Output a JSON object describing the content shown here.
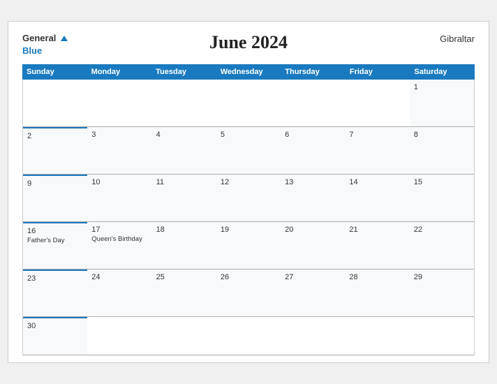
{
  "header": {
    "logo_general": "General",
    "logo_blue": "Blue",
    "title": "June 2024",
    "region": "Gibraltar"
  },
  "days": [
    "Sunday",
    "Monday",
    "Tuesday",
    "Wednesday",
    "Thursday",
    "Friday",
    "Saturday"
  ],
  "weeks": [
    [
      {
        "date": "",
        "empty": true
      },
      {
        "date": "",
        "empty": true
      },
      {
        "date": "",
        "empty": true
      },
      {
        "date": "",
        "empty": true
      },
      {
        "date": "",
        "empty": true
      },
      {
        "date": "",
        "empty": true
      },
      {
        "date": "1",
        "events": []
      }
    ],
    [
      {
        "date": "2",
        "events": [],
        "blueTop": true
      },
      {
        "date": "3",
        "events": []
      },
      {
        "date": "4",
        "events": []
      },
      {
        "date": "5",
        "events": []
      },
      {
        "date": "6",
        "events": []
      },
      {
        "date": "7",
        "events": []
      },
      {
        "date": "8",
        "events": []
      }
    ],
    [
      {
        "date": "9",
        "events": [],
        "blueTop": true
      },
      {
        "date": "10",
        "events": []
      },
      {
        "date": "11",
        "events": []
      },
      {
        "date": "12",
        "events": []
      },
      {
        "date": "13",
        "events": []
      },
      {
        "date": "14",
        "events": []
      },
      {
        "date": "15",
        "events": []
      }
    ],
    [
      {
        "date": "16",
        "events": [
          "Father's Day"
        ],
        "blueTop": true
      },
      {
        "date": "17",
        "events": [
          "Queen's Birthday"
        ]
      },
      {
        "date": "18",
        "events": []
      },
      {
        "date": "19",
        "events": []
      },
      {
        "date": "20",
        "events": []
      },
      {
        "date": "21",
        "events": []
      },
      {
        "date": "22",
        "events": []
      }
    ],
    [
      {
        "date": "23",
        "events": [],
        "blueTop": true
      },
      {
        "date": "24",
        "events": []
      },
      {
        "date": "25",
        "events": []
      },
      {
        "date": "26",
        "events": []
      },
      {
        "date": "27",
        "events": []
      },
      {
        "date": "28",
        "events": []
      },
      {
        "date": "29",
        "events": []
      }
    ],
    [
      {
        "date": "30",
        "events": [],
        "blueTop": true
      },
      {
        "date": "",
        "empty": true
      },
      {
        "date": "",
        "empty": true
      },
      {
        "date": "",
        "empty": true
      },
      {
        "date": "",
        "empty": true
      },
      {
        "date": "",
        "empty": true
      },
      {
        "date": "",
        "empty": true
      }
    ]
  ]
}
